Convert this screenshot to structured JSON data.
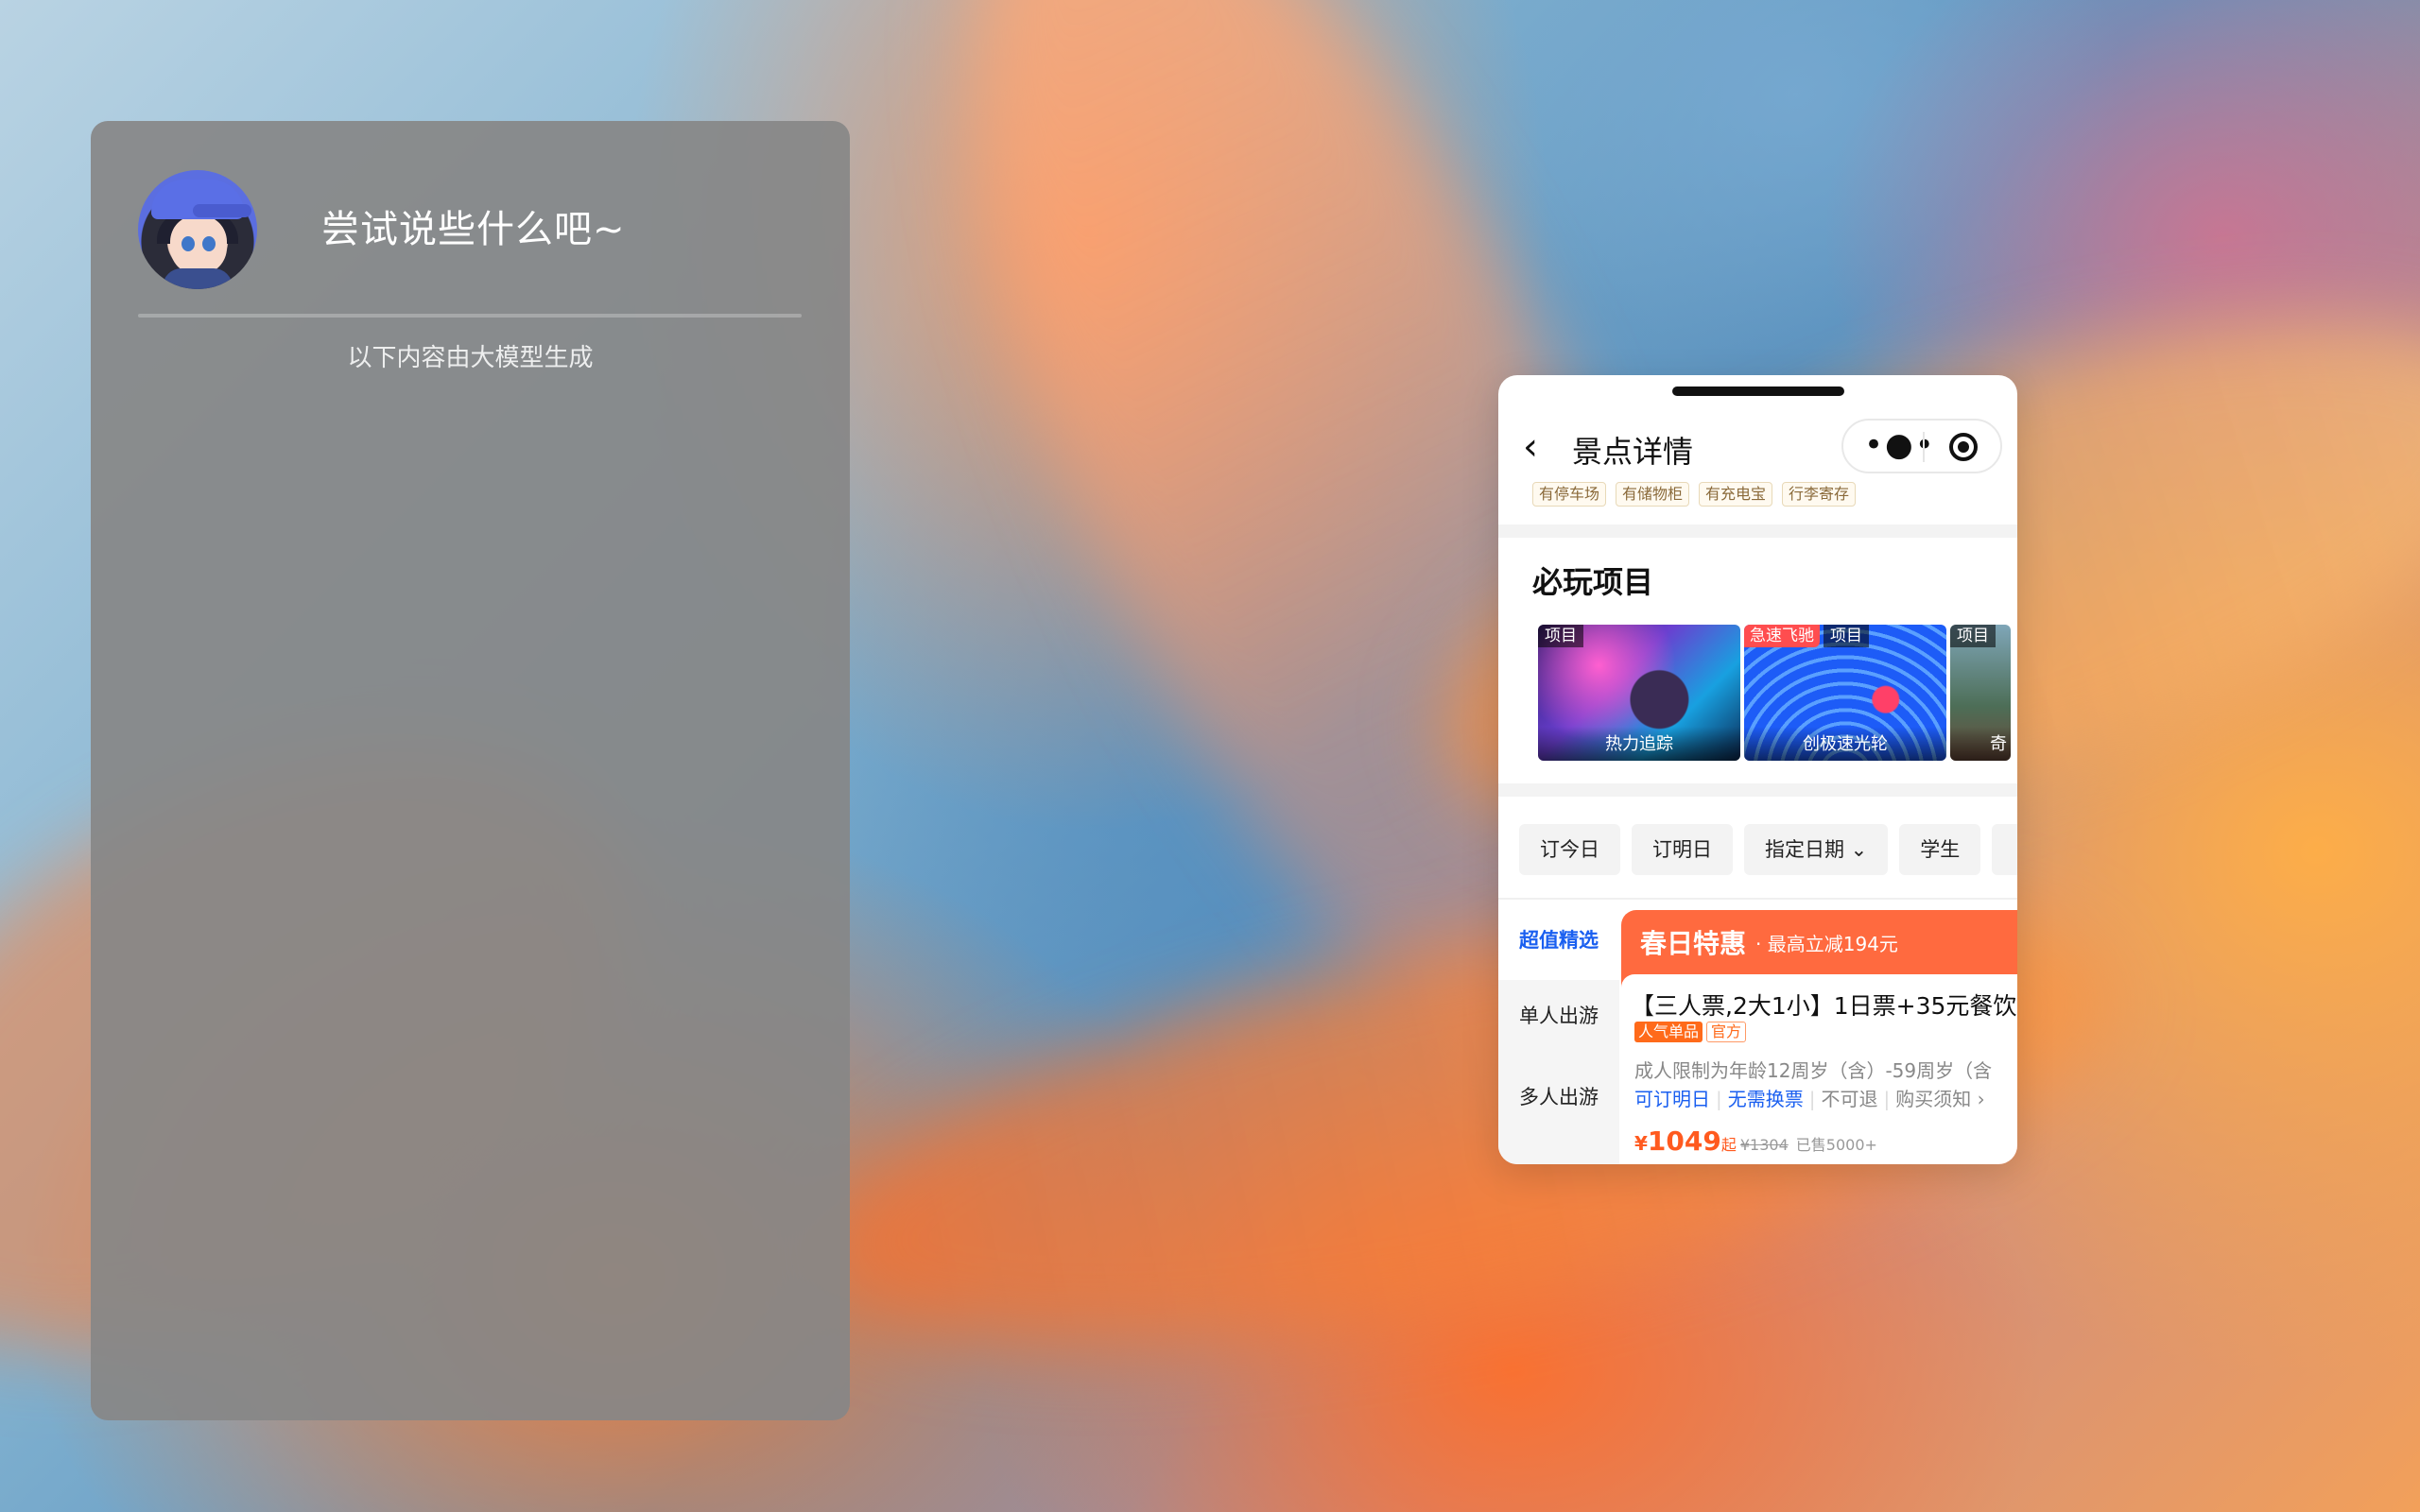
{
  "assistant": {
    "prompt": "尝试说些什么吧~",
    "note": "以下内容由大模型生成"
  },
  "miniapp": {
    "nav": {
      "back_icon": "chevron-left-icon",
      "title": "景点详情",
      "more_icon": "more-dots-icon",
      "close_icon": "target-icon"
    },
    "facilities": [
      "有停车场",
      "有储物柜",
      "有充电宝",
      "行李寄存"
    ],
    "must_play": {
      "title": "必玩项目",
      "cards": [
        {
          "tag": "项目",
          "hot": "",
          "name": "热力追踪"
        },
        {
          "tag": "项目",
          "hot": "急速飞驰",
          "name": "创极速光轮"
        },
        {
          "tag": "项目",
          "hot": "",
          "name": "奇"
        }
      ]
    },
    "filters": [
      "订今日",
      "订明日",
      "指定日期 ⌄",
      "学生"
    ],
    "side_nav": [
      "超值精选",
      "单人出游",
      "多人出游"
    ],
    "promo": {
      "title": "春日特惠",
      "subtitle": "· 最高立减194元"
    },
    "product": {
      "title": "【三人票,2大1小】1日票+35元餐饮",
      "badge_hot": "人气单品",
      "badge_official": "官方",
      "desc": "成人限制为年龄12周岁（含）-59周岁（含",
      "features": [
        "可订明日",
        "无需换票",
        "不可退",
        "购买须知 ›"
      ],
      "currency": "¥",
      "price": "1049",
      "price_suffix": "起",
      "original_price": "¥1304",
      "sold": "已售5000+"
    },
    "colors": {
      "accent_blue": "#1a5ff0",
      "promo_orange": "#ff6a3f",
      "price_orange": "#ff5a1f"
    }
  }
}
